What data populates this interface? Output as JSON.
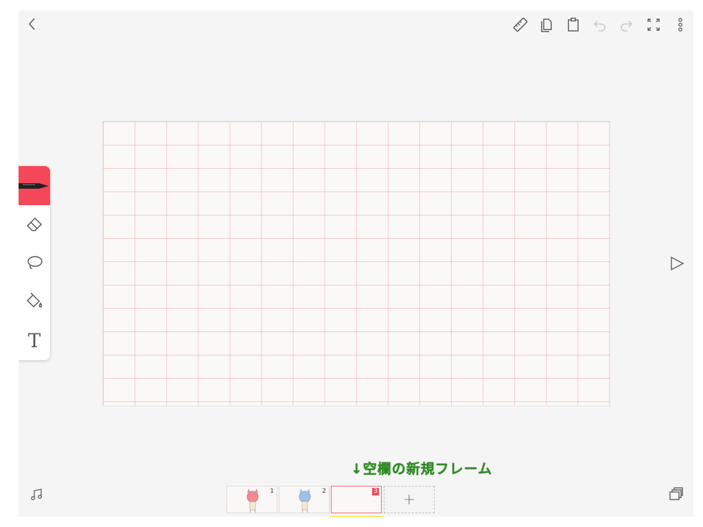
{
  "top_bar": {
    "icons": [
      "back-arrow-icon",
      "ruler-icon",
      "copy-icon",
      "paste-icon",
      "undo-icon",
      "redo-icon",
      "fullscreen-icon",
      "more-icon"
    ]
  },
  "tools": [
    {
      "name": "pen",
      "active": true
    },
    {
      "name": "eraser",
      "active": false
    },
    {
      "name": "lasso",
      "active": false
    },
    {
      "name": "bucket",
      "active": false
    },
    {
      "name": "text",
      "active": false,
      "glyph": "T"
    }
  ],
  "frames": [
    {
      "number": "1",
      "selected": false
    },
    {
      "number": "2",
      "selected": false
    },
    {
      "number": "3",
      "selected": true
    }
  ],
  "add_frame_label": "+",
  "annotation_text": "↓空欄の新規フレーム",
  "colors": {
    "accent": "#f4485a",
    "annotation": "#2e8b22",
    "highlight": "#f9e214"
  }
}
